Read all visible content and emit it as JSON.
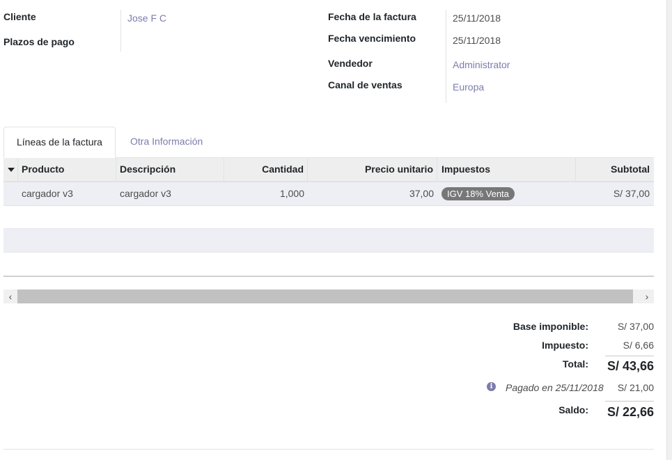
{
  "left_fields": {
    "cliente_label": "Cliente",
    "cliente_value": "Jose F C",
    "plazos_label": "Plazos de pago"
  },
  "right_fields": {
    "fecha_factura_label": "Fecha de la factura",
    "fecha_factura_value": "25/11/2018",
    "fecha_venc_label": "Fecha vencimiento",
    "fecha_venc_value": "25/11/2018",
    "vendedor_label": "Vendedor",
    "vendedor_value": "Administrator",
    "canal_label": "Canal de ventas",
    "canal_value": "Europa"
  },
  "tabs": [
    {
      "label": "Líneas de la factura",
      "active": true
    },
    {
      "label": "Otra Información",
      "active": false
    }
  ],
  "table": {
    "columns": [
      "Producto",
      "Descripción",
      "Cantidad",
      "Precio unitario",
      "Impuestos",
      "Subtotal"
    ],
    "rows": [
      {
        "producto": "cargador v3",
        "descripcion": "cargador v3",
        "cantidad": "1,000",
        "precio": "37,00",
        "impuesto": "IGV 18% Venta",
        "subtotal": "S/ 37,00"
      }
    ]
  },
  "scrollbar": {
    "left_arrow": "‹",
    "right_arrow": "›"
  },
  "totals": {
    "base_label": "Base imponible:",
    "base_value": "S/ 37,00",
    "impuesto_label": "Impuesto:",
    "impuesto_value": "S/ 6,66",
    "total_label": "Total:",
    "total_value": "S/ 43,66",
    "info_icon": "i",
    "pagado_text": "Pagado en 25/11/2018",
    "pagado_value": "S/ 21,00",
    "saldo_label": "Saldo:",
    "saldo_value": "S/ 22,66"
  },
  "colors": {
    "link": "#7c7bad",
    "badge": "#777777",
    "row_bg": "#eeeef5"
  }
}
